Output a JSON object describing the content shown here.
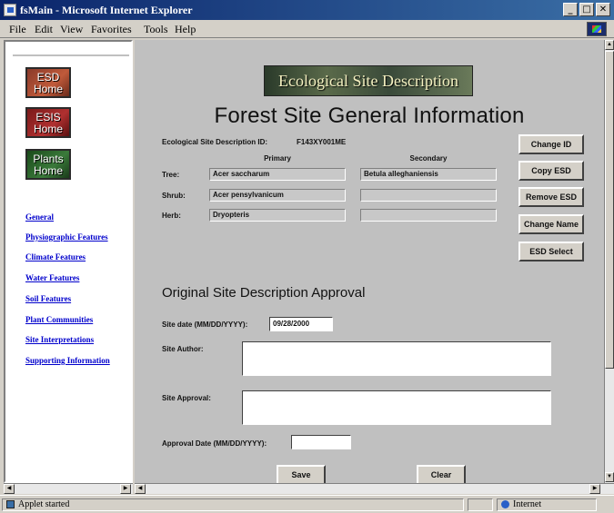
{
  "window": {
    "title": "fsMain - Microsoft Internet Explorer",
    "min": "_",
    "max": "□",
    "close": "✕"
  },
  "menu": [
    "File",
    "Edit",
    "View",
    "Favorites",
    "Tools",
    "Help"
  ],
  "nav_buttons": {
    "esd": "ESD Home",
    "esis": "ESIS Home",
    "plants": "Plants Home"
  },
  "nav_links": [
    "General",
    "Physiographic Features",
    "Climate Features",
    "Water Features",
    "Soil Features",
    "Plant Communities",
    "Site Interpretations",
    "Supporting Information"
  ],
  "banner": "Ecological Site Description",
  "page_title": "Forest Site General Information",
  "site_id_label": "Ecological Site Description ID:",
  "site_id_value": "F143XY001ME",
  "columns": {
    "primary": "Primary",
    "secondary": "Secondary"
  },
  "rows": [
    {
      "label": "Tree:",
      "primary": "Acer saccharum",
      "secondary": "Betula alleghaniensis"
    },
    {
      "label": "Shrub:",
      "primary": "Acer pensylvanicum",
      "secondary": ""
    },
    {
      "label": "Herb:",
      "primary": "Dryopteris",
      "secondary": ""
    }
  ],
  "actions": [
    "Change ID",
    "Copy ESD",
    "Remove ESD",
    "Change Name",
    "ESD Select"
  ],
  "section_title": "Original Site Description Approval",
  "form": {
    "site_date_label": "Site date (MM/DD/YYYY):",
    "site_date_value": "09/28/2000",
    "author_label": "Site Author:",
    "author_value": "",
    "approval_label": "Site Approval:",
    "approval_value": "",
    "approval_date_label": "Approval Date (MM/DD/YYYY):",
    "approval_date_value": ""
  },
  "form_buttons": {
    "save": "Save",
    "clear": "Clear"
  },
  "status": {
    "text": "Applet started",
    "zone": "Internet"
  }
}
